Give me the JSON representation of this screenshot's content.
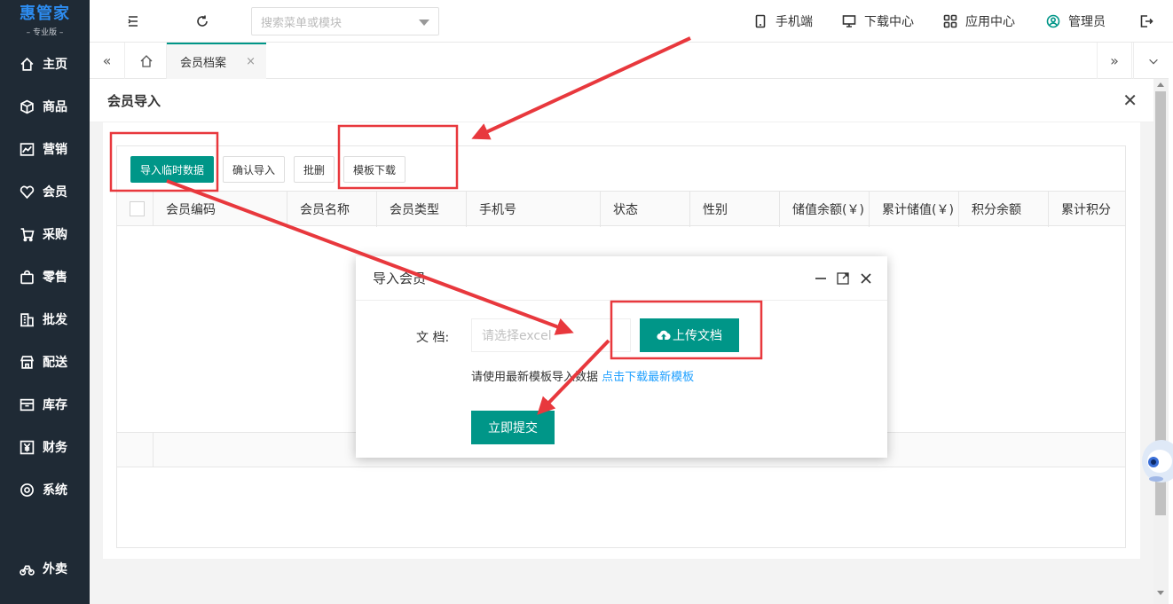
{
  "brand": {
    "name": "惠管家",
    "edition": "专业版"
  },
  "sidebar": {
    "items": [
      {
        "label": "主页",
        "icon": "home-icon"
      },
      {
        "label": "商品",
        "icon": "box-icon"
      },
      {
        "label": "营销",
        "icon": "chart-icon"
      },
      {
        "label": "会员",
        "icon": "heart-icon"
      },
      {
        "label": "采购",
        "icon": "cart-icon"
      },
      {
        "label": "零售",
        "icon": "bag-icon"
      },
      {
        "label": "批发",
        "icon": "building-icon"
      },
      {
        "label": "配送",
        "icon": "shop-icon"
      },
      {
        "label": "库存",
        "icon": "inbox-icon"
      },
      {
        "label": "财务",
        "icon": "yen-icon"
      },
      {
        "label": "系统",
        "icon": "settings-icon"
      }
    ],
    "bottom_item": {
      "label": "外卖",
      "icon": "bike-icon"
    }
  },
  "topbar": {
    "search_placeholder": "搜索菜单或模块",
    "mobile": "手机端",
    "download_center": "下载中心",
    "app_center": "应用中心",
    "user": "管理员"
  },
  "tabs": {
    "active": "会员档案",
    "close": "×"
  },
  "panel": {
    "title": "会员导入",
    "toolbar": {
      "import_temp": "导入临时数据",
      "confirm_import": "确认导入",
      "batch_delete": "批删",
      "template_download": "模板下载"
    },
    "columns": [
      "会员编码",
      "会员名称",
      "会员类型",
      "手机号",
      "状态",
      "性别",
      "储值余额(￥)",
      "累计储值(￥)",
      "积分余额",
      "累计积分"
    ]
  },
  "dialog": {
    "title": "导入会员",
    "doc_label": "文 档:",
    "doc_placeholder": "请选择excel",
    "upload_label": "上传文档",
    "hint_text": "请使用最新模板导入数据",
    "hint_link": "点击下载最新模板",
    "submit_label": "立即提交"
  },
  "colors": {
    "primary": "#009688",
    "sidebar_bg": "#1f2a35",
    "link": "#1e9fff",
    "annotation": "#e8383d"
  }
}
